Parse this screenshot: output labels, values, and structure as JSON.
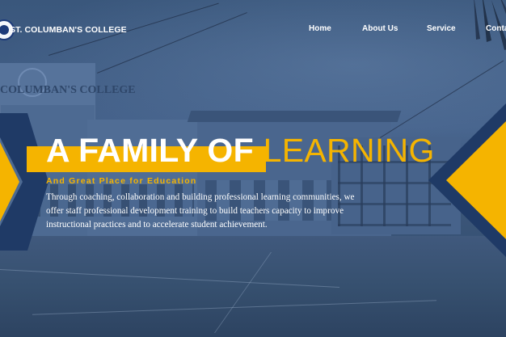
{
  "brand": {
    "name": "ST. COLUMBAN'S COLLEGE",
    "logo_icon": "college-seal-icon"
  },
  "nav": {
    "items": [
      {
        "label": "Home"
      },
      {
        "label": "About Us"
      },
      {
        "label": "Service"
      },
      {
        "label": "Contact"
      }
    ]
  },
  "background": {
    "building_sign": "COLUMBAN'S COLLEGE"
  },
  "hero": {
    "title_part1": "A FAMILY OF",
    "title_part2": "LEARNING",
    "subtitle": "And Great Place for Education",
    "body_lines": [
      "Through coaching, collaboration and building professional learning communities, we",
      "offer staff professional development training to build teachers capacity to improve",
      "instructional practices and to accelerate student achievement."
    ]
  },
  "colors": {
    "accent": "#f5b400",
    "navy": "#1f3a66",
    "overlay": "#3d5a7e",
    "text": "#ffffff"
  }
}
